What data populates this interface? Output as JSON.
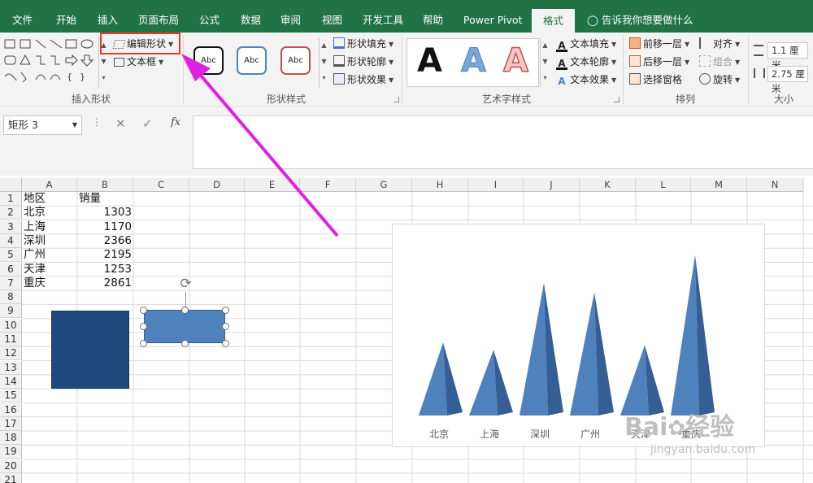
{
  "tabs": [
    "文件",
    "开始",
    "插入",
    "页面布局",
    "公式",
    "数据",
    "审阅",
    "视图",
    "开发工具",
    "帮助",
    "Power Pivot",
    "格式"
  ],
  "active_tab": "格式",
  "tell_me": "告诉我你想要做什么",
  "ribbon": {
    "insert_shapes": {
      "label": "插入形状",
      "edit_shape": "编辑形状",
      "text_box": "文本框"
    },
    "shape_styles": {
      "label": "形状样式",
      "preset": [
        "Abc",
        "Abc",
        "Abc"
      ],
      "fill": "形状填充",
      "outline": "形状轮廓",
      "effects": "形状效果"
    },
    "wordart": {
      "label": "艺术字样式",
      "letters": [
        "A",
        "A",
        "A"
      ],
      "text_fill": "文本填充",
      "text_outline": "文本轮廓",
      "text_effects": "文本效果"
    },
    "arrange": {
      "label": "排列",
      "bring_forward": "前移一层",
      "send_backward": "后移一层",
      "selection_pane": "选择窗格",
      "align": "对齐",
      "group": "组合",
      "rotate": "旋转"
    },
    "size": {
      "label": "大小",
      "height": "1.1 厘米",
      "width": "2.75 厘米"
    }
  },
  "formula_bar": {
    "name_box": "矩形 3",
    "cancel": "✕",
    "enter": "✓",
    "fx": "fx",
    "value": ""
  },
  "sheet": {
    "columns": [
      "A",
      "B",
      "C",
      "D",
      "E",
      "F",
      "G",
      "H",
      "I",
      "J",
      "K",
      "L",
      "M",
      "N"
    ],
    "rows": [
      "1",
      "2",
      "3",
      "4",
      "5",
      "6",
      "7",
      "8",
      "9",
      "10",
      "11",
      "12",
      "13",
      "14",
      "15",
      "16",
      "17",
      "18",
      "19",
      "20",
      "21"
    ],
    "header": [
      "地区",
      "销量"
    ],
    "data": [
      [
        "北京",
        "1303"
      ],
      [
        "上海",
        "1170"
      ],
      [
        "深圳",
        "2366"
      ],
      [
        "广州",
        "2195"
      ],
      [
        "天津",
        "1253"
      ],
      [
        "重庆",
        "2861"
      ]
    ]
  },
  "chart_data": {
    "type": "bar",
    "subtype": "3d-pyramid",
    "categories": [
      "北京",
      "上海",
      "深圳",
      "广州",
      "天津",
      "重庆"
    ],
    "values": [
      1303,
      1170,
      2366,
      2195,
      1253,
      2861
    ],
    "title": "",
    "xlabel": "",
    "ylabel": "",
    "ylim": [
      0,
      3000
    ],
    "grid": false,
    "color": "#4f81bd"
  },
  "watermark": {
    "brand": "Bai",
    "brand_cn": "经验",
    "url": "jingyan.baidu.com"
  },
  "colors": {
    "ribbon_green": "#217346",
    "highlight_red": "#e53935",
    "arrow_magenta": "#e020e0",
    "shape_dark": "#1f497d",
    "shape_blue": "#4f81bd"
  }
}
